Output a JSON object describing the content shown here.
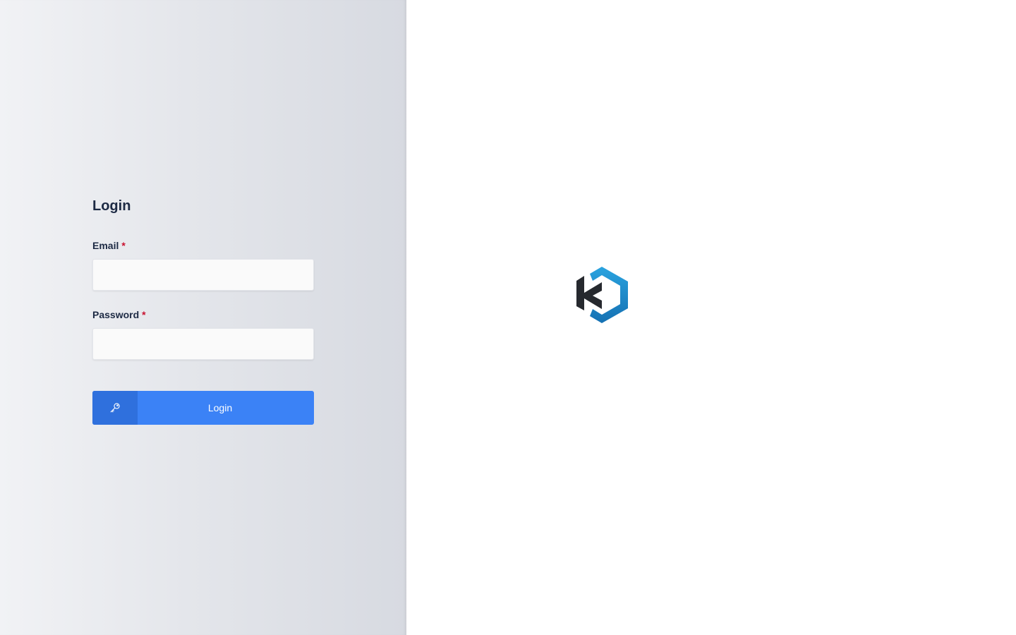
{
  "login": {
    "title": "Login",
    "email_label": "Email",
    "password_label": "Password",
    "required_mark": "*",
    "email_value": "",
    "password_value": "",
    "button_label": "Login",
    "button_icon": "key-icon"
  },
  "brand": {
    "logo_icon": "k-hexagon-logo",
    "colors": {
      "logo_blue": "#1a8fd6",
      "logo_dark": "#26292e",
      "button_primary": "#3b82f6",
      "button_icon_bg": "#2f70dd",
      "required": "#c8102e"
    }
  }
}
